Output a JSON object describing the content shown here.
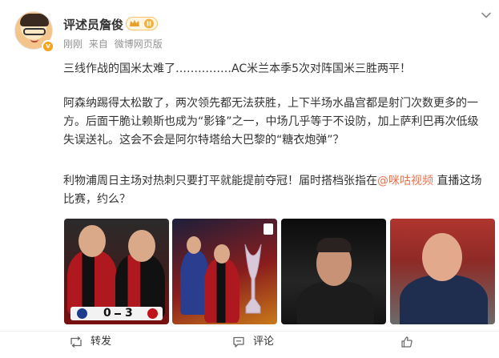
{
  "post": {
    "author": {
      "name": "评述员詹俊",
      "verified_badge": "v",
      "level_badge": "II"
    },
    "meta": {
      "time": "刚刚",
      "source_prefix": "来自",
      "source": "微博网页版"
    },
    "paragraphs": {
      "p1": "三线作战的国米太难了……………AC米兰本季5次对阵国米三胜两平！",
      "p2": "阿森纳踢得太松散了，两次领先都无法获胜，上下半场水晶宫都是射门次数更多的一方。后面干脆让赖斯也成为“影锋”之一，中场几乎等于不设防，加上萨利巴再次低级失误送礼。这会不会是阿尔特塔给大巴黎的“糖衣炮弹”？",
      "p3_before": "利物浦周日主场对热刺只要打平就能提前夺冠！届时搭档张指在",
      "p3_mention": "@咪咕视频",
      "p3_after": " 直播这场比赛，约么？"
    },
    "photos": {
      "score_home": "0",
      "score_away": "3"
    },
    "actions": {
      "repost": "转发",
      "comment": "评论",
      "like": ""
    },
    "icons": {
      "more": "chevron-down-icon",
      "repost": "repost-icon",
      "comment": "comment-icon",
      "like": "thumbs-up-icon"
    },
    "colors": {
      "mention": "#eb7350",
      "meta_text": "#939393",
      "verified": "#f7a21b"
    }
  }
}
